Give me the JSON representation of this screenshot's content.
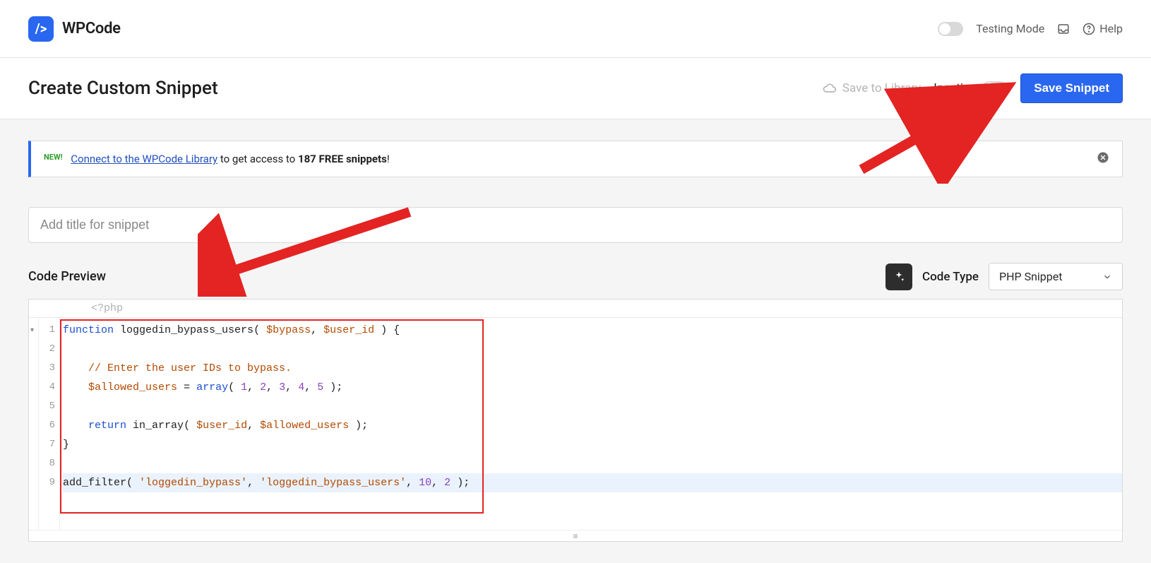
{
  "brand": {
    "name": "WPCode",
    "logo_glyph": "/>"
  },
  "topbar": {
    "testing_label": "Testing Mode",
    "help_label": "Help"
  },
  "header": {
    "title": "Create Custom Snippet",
    "save_to_library": "Save to Library",
    "inactive_label": "Inactive",
    "save_btn": "Save Snippet"
  },
  "notice": {
    "new_tag": "NEW!",
    "link_text": "Connect to the WPCode Library",
    "mid_text": " to get access to ",
    "count_bold": "187 FREE snippets",
    "tail_text": "!"
  },
  "title_input": {
    "placeholder": "Add title for snippet"
  },
  "code_section": {
    "heading": "Code Preview",
    "code_type_label": "Code Type",
    "code_type_value": "PHP Snippet"
  },
  "code": {
    "prelude": "<?php",
    "lines": [
      {
        "n": 1,
        "frags": [
          {
            "t": "function",
            "c": "kw"
          },
          {
            "t": " ",
            "c": "pn"
          },
          {
            "t": "loggedin_bypass_users",
            "c": "fn"
          },
          {
            "t": "( ",
            "c": "pn"
          },
          {
            "t": "$bypass",
            "c": "var"
          },
          {
            "t": ", ",
            "c": "pn"
          },
          {
            "t": "$user_id",
            "c": "var"
          },
          {
            "t": " ) {",
            "c": "pn"
          }
        ]
      },
      {
        "n": 2,
        "frags": []
      },
      {
        "n": 3,
        "frags": [
          {
            "t": "    ",
            "c": "pn"
          },
          {
            "t": "// Enter the user IDs to bypass.",
            "c": "cm"
          }
        ]
      },
      {
        "n": 4,
        "frags": [
          {
            "t": "    ",
            "c": "pn"
          },
          {
            "t": "$allowed_users",
            "c": "var"
          },
          {
            "t": " = ",
            "c": "pn"
          },
          {
            "t": "array",
            "c": "kw"
          },
          {
            "t": "( ",
            "c": "pn"
          },
          {
            "t": "1",
            "c": "num"
          },
          {
            "t": ", ",
            "c": "pn"
          },
          {
            "t": "2",
            "c": "num"
          },
          {
            "t": ", ",
            "c": "pn"
          },
          {
            "t": "3",
            "c": "num"
          },
          {
            "t": ", ",
            "c": "pn"
          },
          {
            "t": "4",
            "c": "num"
          },
          {
            "t": ", ",
            "c": "pn"
          },
          {
            "t": "5",
            "c": "num"
          },
          {
            "t": " );",
            "c": "pn"
          }
        ]
      },
      {
        "n": 5,
        "frags": []
      },
      {
        "n": 6,
        "frags": [
          {
            "t": "    ",
            "c": "pn"
          },
          {
            "t": "return",
            "c": "kw"
          },
          {
            "t": " ",
            "c": "pn"
          },
          {
            "t": "in_array",
            "c": "fn"
          },
          {
            "t": "( ",
            "c": "pn"
          },
          {
            "t": "$user_id",
            "c": "var"
          },
          {
            "t": ", ",
            "c": "pn"
          },
          {
            "t": "$allowed_users",
            "c": "var"
          },
          {
            "t": " );",
            "c": "pn"
          }
        ]
      },
      {
        "n": 7,
        "frags": [
          {
            "t": "}",
            "c": "pn"
          }
        ]
      },
      {
        "n": 8,
        "frags": []
      },
      {
        "n": 9,
        "hl": true,
        "frags": [
          {
            "t": "add_filter",
            "c": "fn"
          },
          {
            "t": "( ",
            "c": "pn"
          },
          {
            "t": "'loggedin_bypass'",
            "c": "str"
          },
          {
            "t": ", ",
            "c": "pn"
          },
          {
            "t": "'loggedin_bypass_users'",
            "c": "str"
          },
          {
            "t": ", ",
            "c": "pn"
          },
          {
            "t": "10",
            "c": "num"
          },
          {
            "t": ", ",
            "c": "pn"
          },
          {
            "t": "2",
            "c": "num"
          },
          {
            "t": " );",
            "c": "pn"
          }
        ]
      }
    ]
  }
}
